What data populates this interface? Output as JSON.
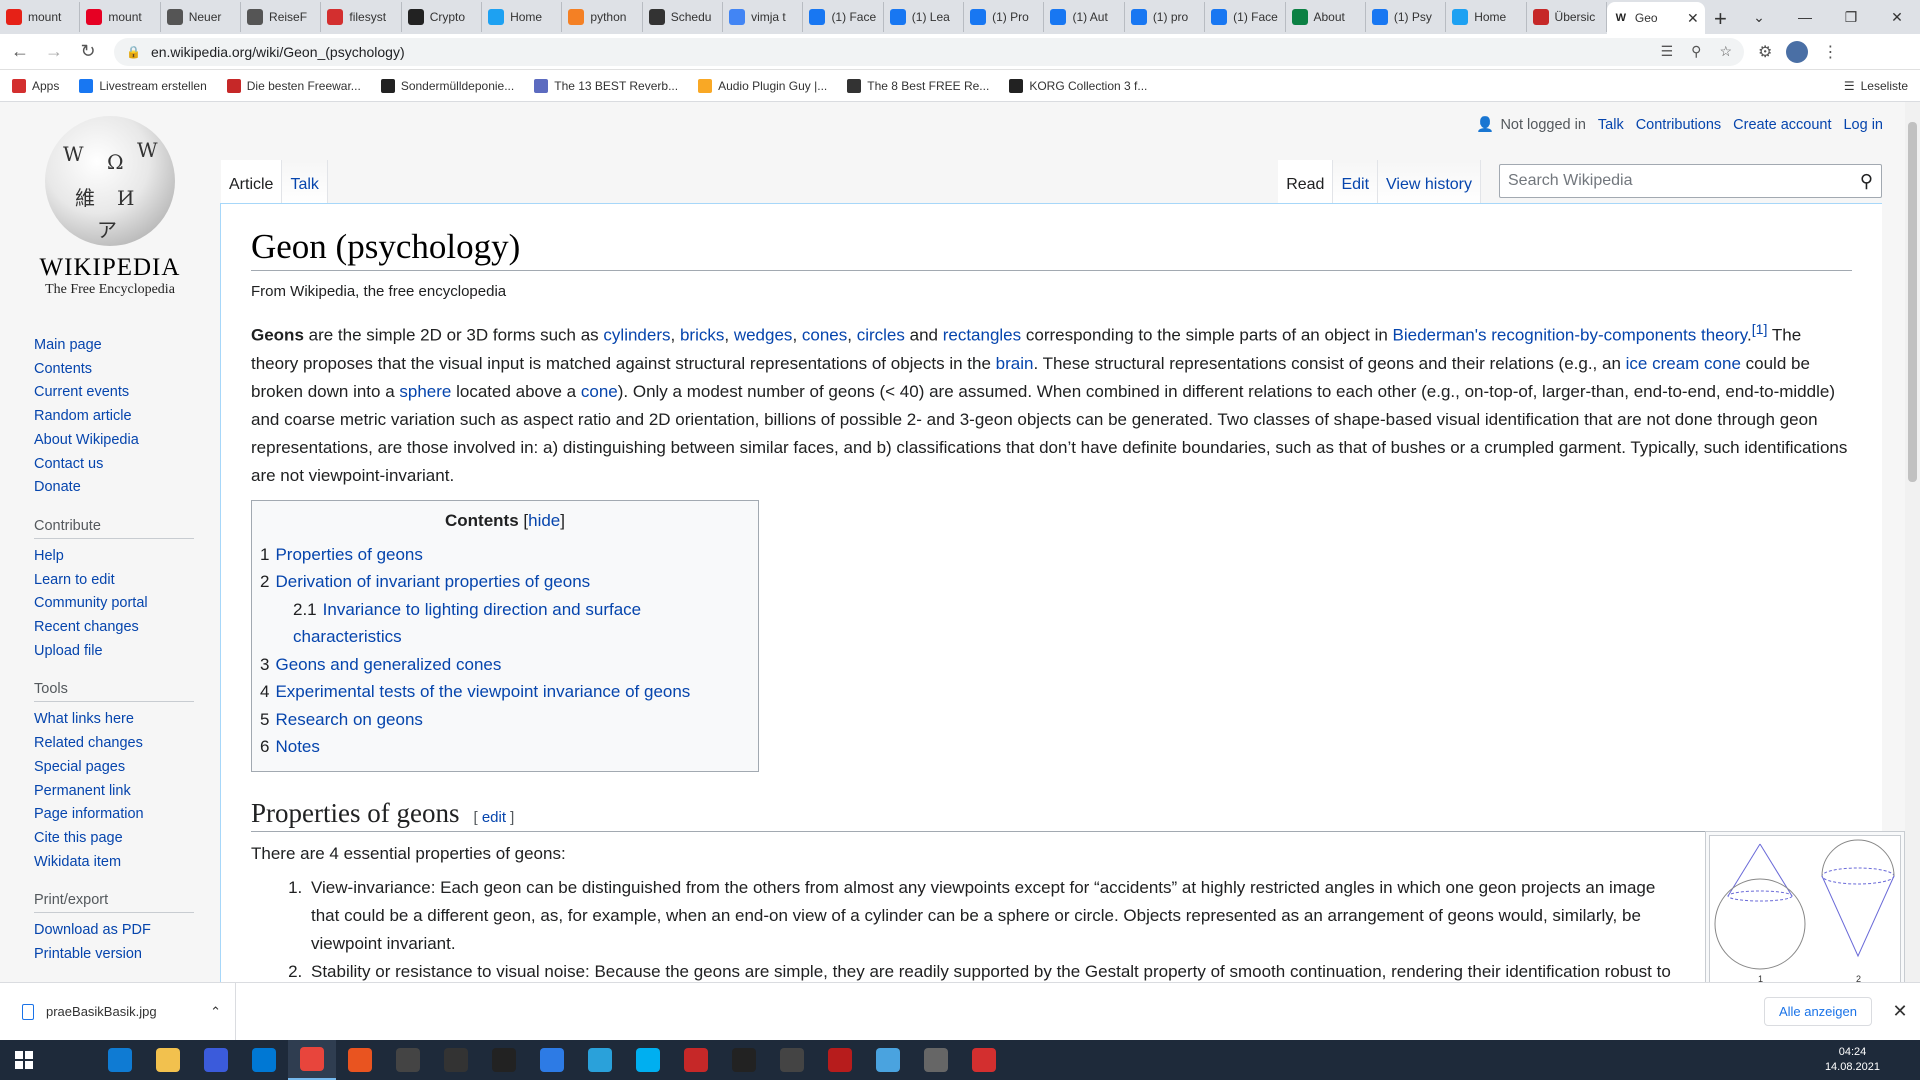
{
  "browser": {
    "tabs": [
      {
        "label": "mount",
        "icon": "youtube-icon",
        "color": "#e62117"
      },
      {
        "label": "mount",
        "icon": "pinterest-icon",
        "color": "#e60023"
      },
      {
        "label": "Neuer",
        "icon": "generic-icon",
        "color": "#555555"
      },
      {
        "label": "ReiseF",
        "icon": "generic-icon",
        "color": "#555555"
      },
      {
        "label": "filesyst",
        "icon": "grid-icon",
        "color": "#d32f2f"
      },
      {
        "label": "Crypto",
        "icon": "wikipedia-icon",
        "color": "#222222"
      },
      {
        "label": "Home",
        "icon": "twitter-icon",
        "color": "#1da1f2"
      },
      {
        "label": "python",
        "icon": "stack-icon",
        "color": "#f48024"
      },
      {
        "label": "Schedu",
        "icon": "arrow-icon",
        "color": "#333333"
      },
      {
        "label": "vimja t",
        "icon": "google-icon",
        "color": "#4285f4"
      },
      {
        "label": "(1) Face",
        "icon": "facebook-icon",
        "color": "#1877f2"
      },
      {
        "label": "(1) Lea",
        "icon": "facebook-icon",
        "color": "#1877f2"
      },
      {
        "label": "(1) Pro",
        "icon": "facebook-icon",
        "color": "#1877f2"
      },
      {
        "label": "(1) Aut",
        "icon": "facebook-icon",
        "color": "#1877f2"
      },
      {
        "label": "(1) pro",
        "icon": "facebook-icon",
        "color": "#1877f2"
      },
      {
        "label": "(1) Face",
        "icon": "facebook-icon",
        "color": "#1877f2"
      },
      {
        "label": "About",
        "icon": "grid-icon",
        "color": "#0b8043"
      },
      {
        "label": "(1) Psy",
        "icon": "facebook-icon",
        "color": "#1877f2"
      },
      {
        "label": "Home",
        "icon": "twitter-icon",
        "color": "#1da1f2"
      },
      {
        "label": "Übersic",
        "icon": "b-icon",
        "color": "#c62828"
      }
    ],
    "active_tab": {
      "label": "Geo",
      "icon": "wikipedia-icon"
    },
    "url": "en.wikipedia.org/wiki/Geon_(psychology)",
    "bookmarks": [
      {
        "label": "Apps",
        "icon": "apps-icon",
        "color": "#d32f2f"
      },
      {
        "label": "Livestream erstellen",
        "icon": "facebook-icon",
        "color": "#1877f2"
      },
      {
        "label": "Die besten Freewar...",
        "icon": "star-icon",
        "color": "#c62828"
      },
      {
        "label": "Sondermülldeponie...",
        "icon": "wikipedia-icon",
        "color": "#222222"
      },
      {
        "label": "The 13 BEST Reverb...",
        "icon": "music-icon",
        "color": "#5c6bc0"
      },
      {
        "label": "Audio Plugin Guy |...",
        "icon": "plugin-icon",
        "color": "#f9a825"
      },
      {
        "label": "The 8 Best FREE Re...",
        "icon": "moon-icon",
        "color": "#333333"
      },
      {
        "label": "KORG Collection 3 f...",
        "icon": "korg-icon",
        "color": "#222222"
      }
    ],
    "reading_list": "Leseliste"
  },
  "wiki": {
    "logo_name": "Wikipedia",
    "logo_tagline": "The Free Encyclopedia",
    "personal": {
      "not_logged_in": "Not logged in",
      "talk": "Talk",
      "contributions": "Contributions",
      "create_account": "Create account",
      "login": "Log in"
    },
    "namespaces": [
      "Article",
      "Talk"
    ],
    "views": [
      "Read",
      "Edit",
      "View history"
    ],
    "search_placeholder": "Search Wikipedia",
    "sidebar": {
      "nav": [
        "Main page",
        "Contents",
        "Current events",
        "Random article",
        "About Wikipedia",
        "Contact us",
        "Donate"
      ],
      "contribute_heading": "Contribute",
      "contribute": [
        "Help",
        "Learn to edit",
        "Community portal",
        "Recent changes",
        "Upload file"
      ],
      "tools_heading": "Tools",
      "tools": [
        "What links here",
        "Related changes",
        "Special pages",
        "Permanent link",
        "Page information",
        "Cite this page",
        "Wikidata item"
      ],
      "print_heading": "Print/export",
      "print": [
        "Download as PDF",
        "Printable version"
      ]
    },
    "title": "Geon (psychology)",
    "site_sub": "From Wikipedia, the free encyclopedia",
    "lead": {
      "bold": "Geons",
      "t1": " are the simple 2D or 3D forms such as ",
      "l_cylinders": "cylinders",
      "l_bricks": "bricks",
      "l_wedges": "wedges",
      "l_cones": "cones",
      "l_circles": "circles",
      "t_and": " and ",
      "l_rectangles": "rectangles",
      "t2": " corresponding to the simple parts of an object in ",
      "l_biederman": "Biederman's recognition-by-components theory",
      "ref1": "[1]",
      "t3": " The theory proposes that the visual input is matched against structural representations of objects in the ",
      "l_brain": "brain",
      "t4": ". These structural representations consist of geons and their relations (e.g., an ",
      "l_icecream": "ice cream cone",
      "t5": " could be broken down into a ",
      "l_sphere": "sphere",
      "t6": " located above a ",
      "l_cone": "cone",
      "t7": "). Only a modest number of geons (< 40) are assumed. When combined in different relations to each other (e.g., on-top-of, larger-than, end-to-end, end-to-middle) and coarse metric variation such as aspect ratio and 2D orientation, billions of possible 2- and 3-geon objects can be generated. Two classes of shape-based visual identification that are not done through geon representations, are those involved in: a) distinguishing between similar faces, and b) classifications that don’t have definite boundaries, such as that of bushes or a crumpled garment. Typically, such identifications are not viewpoint-invariant."
    },
    "toc": {
      "title": "Contents",
      "hide": "hide",
      "items": [
        {
          "num": "1",
          "label": "Properties of geons",
          "sub": false
        },
        {
          "num": "2",
          "label": "Derivation of invariant properties of geons",
          "sub": false
        },
        {
          "num": "2.1",
          "label": "Invariance to lighting direction and surface characteristics",
          "sub": true
        },
        {
          "num": "3",
          "label": "Geons and generalized cones",
          "sub": false
        },
        {
          "num": "4",
          "label": "Experimental tests of the viewpoint invariance of geons",
          "sub": false
        },
        {
          "num": "5",
          "label": "Research on geons",
          "sub": false
        },
        {
          "num": "6",
          "label": "Notes",
          "sub": false
        }
      ]
    },
    "section1": {
      "heading": "Properties of geons",
      "edit": "edit",
      "intro": "There are 4 essential properties of geons:",
      "items": [
        "View-invariance: Each geon can be distinguished from the others from almost any viewpoints except for “accidents” at highly restricted angles in which one geon projects an image that could be a different geon, as, for example, when an end-on view of a cylinder can be a sphere or circle. Objects represented as an arrangement of geons would, similarly, be viewpoint invariant.",
        "Stability or resistance to visual noise: Because the geons are simple, they are readily supported by the Gestalt property of smooth continuation, rendering their identification robust to partial occlusion and degradation by visual noise as, for example, when a cylinder might be viewed behind a bush."
      ],
      "figure_labels": [
        "1",
        "2"
      ]
    }
  },
  "download": {
    "filename": "praeBasikBasik.jpg",
    "show_all": "Alle anzeigen"
  },
  "clock": {
    "time": "04:24",
    "date": "14.08.2021"
  },
  "taskbar": [
    {
      "icon": "search-icon",
      "color": "#1e2a3a"
    },
    {
      "icon": "edge-icon",
      "color": "#0f7bd3"
    },
    {
      "icon": "file-explorer-icon",
      "color": "#f2c14e"
    },
    {
      "icon": "store-icon",
      "color": "#3b5bdb"
    },
    {
      "icon": "mail-icon",
      "color": "#0078d4"
    },
    {
      "icon": "chrome-icon",
      "color": "#e8453c"
    },
    {
      "icon": "ubuntu-icon",
      "color": "#e95420"
    },
    {
      "icon": "app-icon",
      "color": "#444444"
    },
    {
      "icon": "inkscape-icon",
      "color": "#333333"
    },
    {
      "icon": "live-icon",
      "color": "#222222"
    },
    {
      "icon": "chat-icon",
      "color": "#2d7be5"
    },
    {
      "icon": "telegram-icon",
      "color": "#2aa1da"
    },
    {
      "icon": "skype-icon",
      "color": "#00aff0"
    },
    {
      "icon": "fl-icon",
      "color": "#c62828"
    },
    {
      "icon": "kali-icon",
      "color": "#222222"
    },
    {
      "icon": "tool-icon",
      "color": "#444444"
    },
    {
      "icon": "voicemeeter-icon",
      "color": "#b71c1c"
    },
    {
      "icon": "help-icon",
      "color": "#4aa3df"
    },
    {
      "icon": "window-icon",
      "color": "#666666"
    },
    {
      "icon": "pdf-icon",
      "color": "#d32f2f"
    }
  ]
}
